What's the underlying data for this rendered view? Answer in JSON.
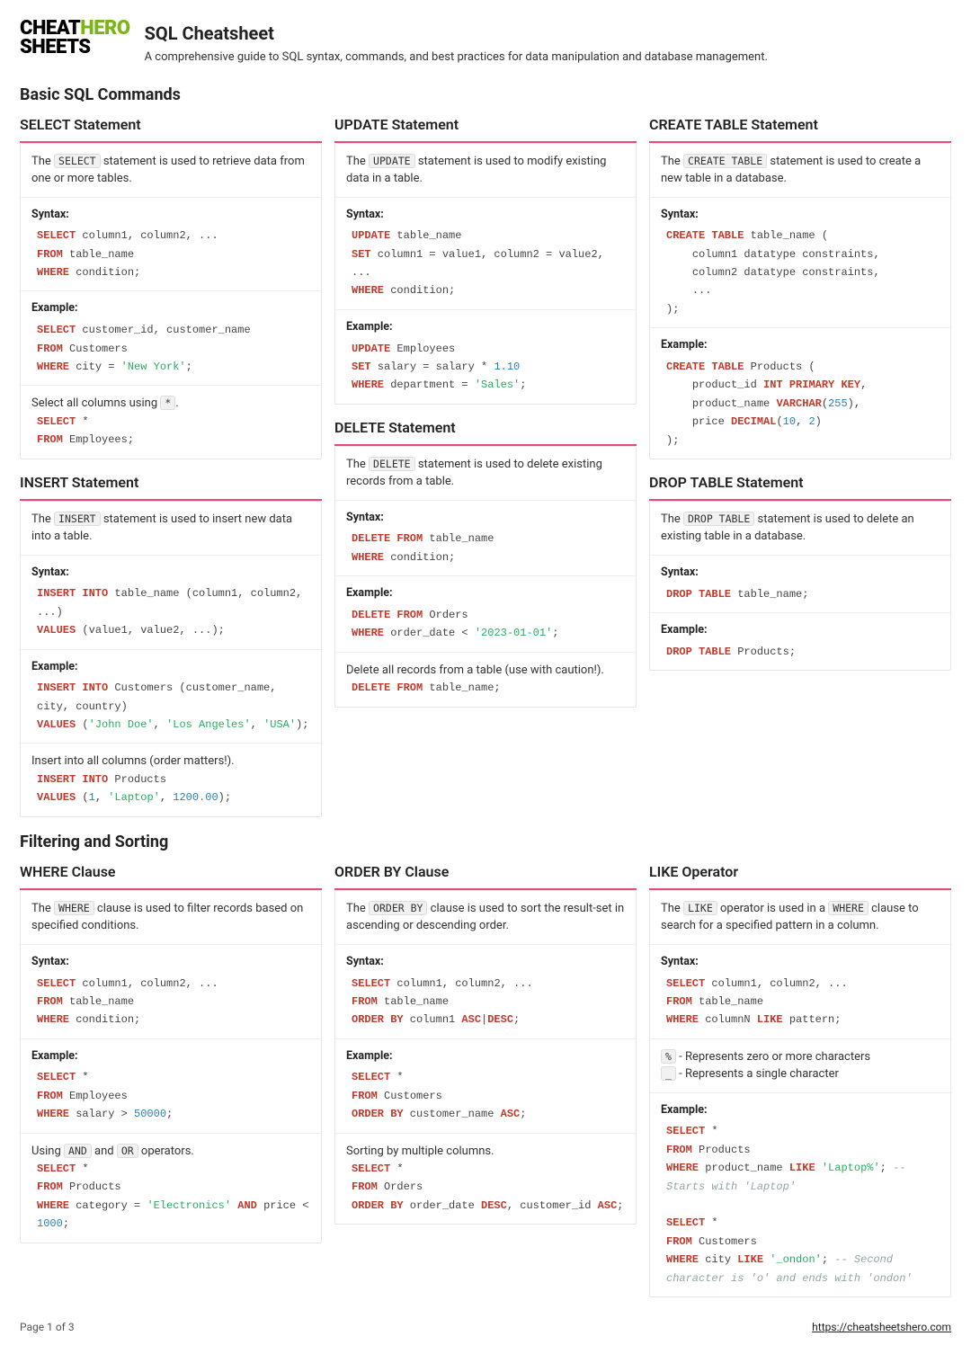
{
  "logo": {
    "l1a": "CHEAT",
    "l1b": "HERO",
    "l2": "SHEETS"
  },
  "title": "SQL Cheatsheet",
  "subtitle": "A comprehensive guide to SQL syntax, commands, and best practices for data manipulation and database management.",
  "sec1": "Basic SQL Commands",
  "sec2": "Filtering and Sorting",
  "labels": {
    "syntax": "Syntax:",
    "example": "Example:"
  },
  "select": {
    "title": "SELECT Statement",
    "d1a": "The ",
    "d1code": "SELECT",
    "d1b": " statement is used to retrieve data from one or more tables.",
    "note1a": "Select all columns using ",
    "note1code": "*",
    "note1b": "."
  },
  "insert": {
    "title": "INSERT Statement",
    "d1a": "The ",
    "d1code": "INSERT",
    "d1b": " statement is used to insert new data into a table.",
    "note1": "Insert into all columns (order matters!)."
  },
  "update": {
    "title": "UPDATE Statement",
    "d1a": "The ",
    "d1code": "UPDATE",
    "d1b": " statement is used to modify existing data in a table."
  },
  "delete": {
    "title": "DELETE Statement",
    "d1a": "The ",
    "d1code": "DELETE",
    "d1b": " statement is used to delete existing records from a table.",
    "note1": "Delete all records from a table (use with caution!)."
  },
  "create": {
    "title": "CREATE TABLE Statement",
    "d1a": "The ",
    "d1code": "CREATE TABLE",
    "d1b": " statement is used to create a new table in a database."
  },
  "drop": {
    "title": "DROP TABLE Statement",
    "d1a": "The ",
    "d1code": "DROP TABLE",
    "d1b": " statement is used to delete an existing table in a database."
  },
  "where": {
    "title": "WHERE Clause",
    "d1a": "The ",
    "d1code": "WHERE",
    "d1b": " clause is used to filter records based on specified conditions.",
    "note1a": "Using ",
    "note1code1": "AND",
    "note1b": " and ",
    "note1code2": "OR",
    "note1c": " operators."
  },
  "orderby": {
    "title": "ORDER BY Clause",
    "d1a": "The ",
    "d1code": "ORDER BY",
    "d1b": " clause is used to sort the result-set in ascending or descending order.",
    "note1": "Sorting by multiple columns."
  },
  "like": {
    "title": "LIKE Operator",
    "d1a": "The ",
    "d1code1": "LIKE",
    "d1b": " operator is used in a ",
    "d1code2": "WHERE",
    "d1c": " clause to search for a specified pattern in a column.",
    "wc1code": "%",
    "wc1": " - Represents zero or more characters",
    "wc2code": "_",
    "wc2": " - Represents a single character"
  },
  "footer": {
    "page": "Page 1 of 3",
    "url": "https://cheatsheetshero.com"
  }
}
